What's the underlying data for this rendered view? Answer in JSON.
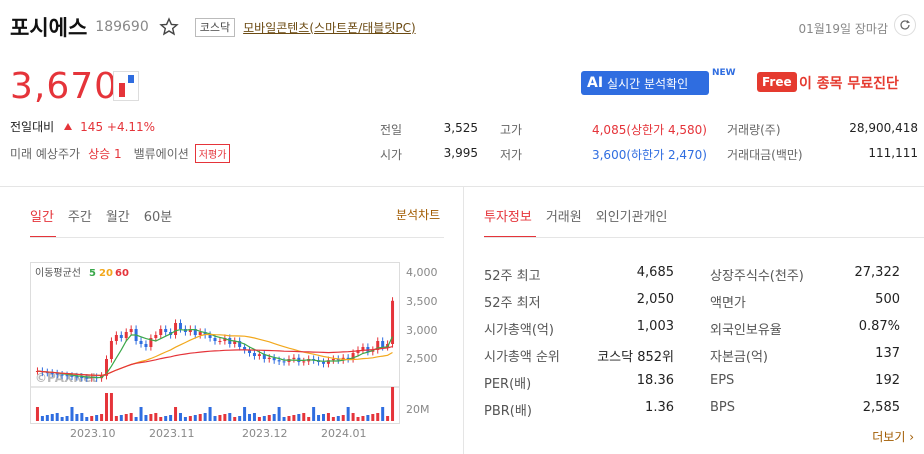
{
  "header": {
    "name": "포시에스",
    "code": "189690",
    "market_badge": "코스닥",
    "sector": "모바일콘텐츠(스마트폰/태블릿PC)",
    "close_time": "01월19일 장마감"
  },
  "price": {
    "current": "3,670",
    "change_label": "전일대비",
    "change": "145 +4.11%",
    "future_label": "미래 예상주가",
    "future_value": "상승 1",
    "valuation_label": "밸류에이션",
    "valuation_value": "저평가"
  },
  "promo": {
    "ai_prefix": "AI",
    "ai_text": "실시간 분석확인",
    "new_tag": "NEW",
    "free_tag": "Free",
    "free_text": "이 종목 무료진단"
  },
  "quote": {
    "prev_close_label": "전일",
    "prev_close": "3,525",
    "open_label": "시가",
    "open": "3,995",
    "high_label": "고가",
    "high": "4,085(상한가 4,580)",
    "low_label": "저가",
    "low": "3,600(하한가 2,470)",
    "volume_label": "거래량(주)",
    "volume": "28,900,418",
    "amount_label": "거래대금(백만)",
    "amount": "111,111"
  },
  "chart_tabs": [
    "일간",
    "주간",
    "월간",
    "60분"
  ],
  "chart_link": "분석차트",
  "chart": {
    "legend_title": "이동평균선",
    "ma5": "5",
    "ma20": "20",
    "ma60": "60",
    "y_ticks": [
      "4,000",
      "3,500",
      "3,000",
      "2,500"
    ],
    "volume_tick": "20M",
    "x_ticks": [
      "2023.10",
      "2023.11",
      "2023.12",
      "2024.01"
    ],
    "watermark": "©PAXNet",
    "colors": {
      "up": "#e5343a",
      "down": "#2f6de0",
      "ma5": "#3aa84a",
      "ma20": "#f2a81d",
      "ma60": "#e5343a"
    }
  },
  "info_tabs": [
    "투자정보",
    "거래원",
    "외인기관개인"
  ],
  "info_left": [
    {
      "k": "52주 최고",
      "v": "4,685"
    },
    {
      "k": "52주 최저",
      "v": "2,050"
    },
    {
      "k": "시가총액(억)",
      "v": "1,003"
    },
    {
      "k": "시가총액 순위",
      "v": "코스닥 852위"
    },
    {
      "k": "PER(배)",
      "v": "18.36"
    },
    {
      "k": "PBR(배)",
      "v": "1.36"
    }
  ],
  "info_right": [
    {
      "k": "상장주식수(천주)",
      "v": "27,322"
    },
    {
      "k": "액면가",
      "v": "500"
    },
    {
      "k": "외국인보유율",
      "v": "0.87%"
    },
    {
      "k": "자본금(억)",
      "v": "137"
    },
    {
      "k": "EPS",
      "v": "192"
    },
    {
      "k": "BPS",
      "v": "2,585"
    }
  ],
  "more_link": "더보기"
}
